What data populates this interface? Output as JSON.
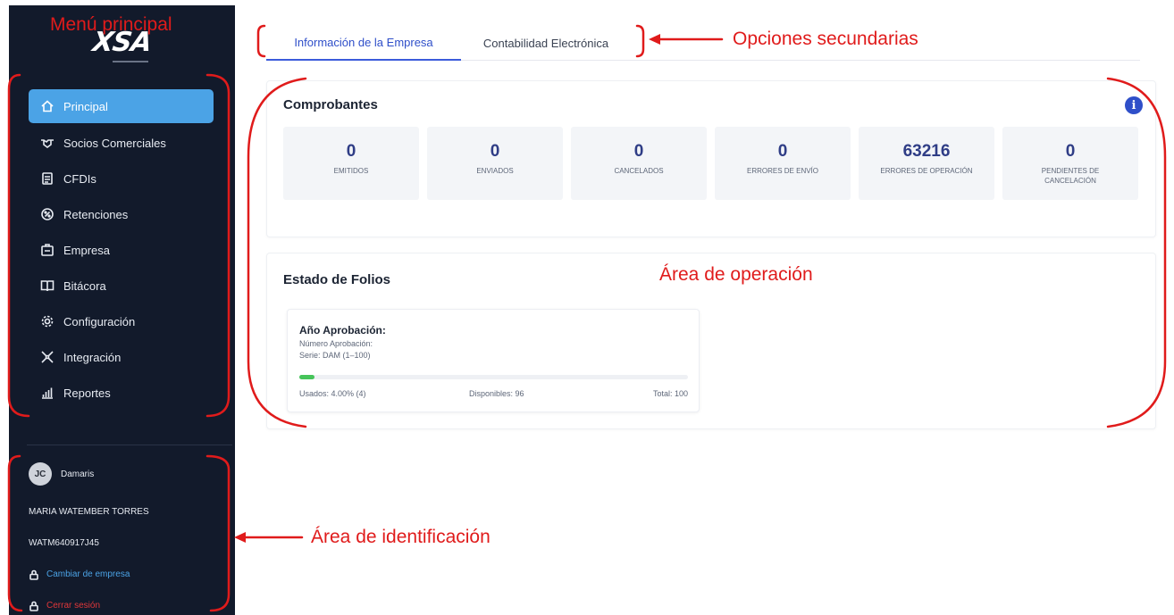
{
  "annotations": {
    "main_menu": "Menú principal",
    "secondary": "Opciones secundarias",
    "operation": "Área de operación",
    "identification": "Área de identificación",
    "color": "#e01b1b"
  },
  "sidebar": {
    "logo": "XSA",
    "items": [
      {
        "label": "Principal",
        "icon": "home-icon",
        "active": true
      },
      {
        "label": "Socios Comerciales",
        "icon": "handshake-icon"
      },
      {
        "label": "CFDIs",
        "icon": "document-icon"
      },
      {
        "label": "Retenciones",
        "icon": "percent-circle-icon"
      },
      {
        "label": "Empresa",
        "icon": "building-icon"
      },
      {
        "label": "Bitácora",
        "icon": "book-icon"
      },
      {
        "label": "Configuración",
        "icon": "gear-icon"
      },
      {
        "label": "Integración",
        "icon": "network-icon"
      },
      {
        "label": "Reportes",
        "icon": "chart-icon"
      }
    ],
    "accent": "#4ba3e6",
    "background": "#121a2b"
  },
  "identity": {
    "initials": "JC",
    "username": "Damaris",
    "full_name": "MARIA WATEMBER TORRES",
    "rfc": "WATM640917J45",
    "change_company": "Cambiar de empresa",
    "logout": "Cerrar sesión"
  },
  "tabs": [
    {
      "label": "Información de la Empresa",
      "active": true
    },
    {
      "label": "Contabilidad Electrónica"
    }
  ],
  "comprobantes": {
    "title": "Comprobantes",
    "stats": [
      {
        "value": "0",
        "label": "Emitidos"
      },
      {
        "value": "0",
        "label": "Enviados"
      },
      {
        "value": "0",
        "label": "Cancelados"
      },
      {
        "value": "0",
        "label": "Errores de envío"
      },
      {
        "value": "63216",
        "label": "Errores de operación"
      },
      {
        "value": "0",
        "label": "Pendientes de cancelación"
      }
    ]
  },
  "folios": {
    "title": "Estado de Folios",
    "card": {
      "heading": "Año Aprobación:",
      "approval_number": "Número Aprobación:",
      "series": "Serie: DAM (1–100)",
      "used": "Usados: 4.00% (4)",
      "available": "Disponibles: 96",
      "total": "Total: 100",
      "used_fraction": 0.04
    }
  }
}
